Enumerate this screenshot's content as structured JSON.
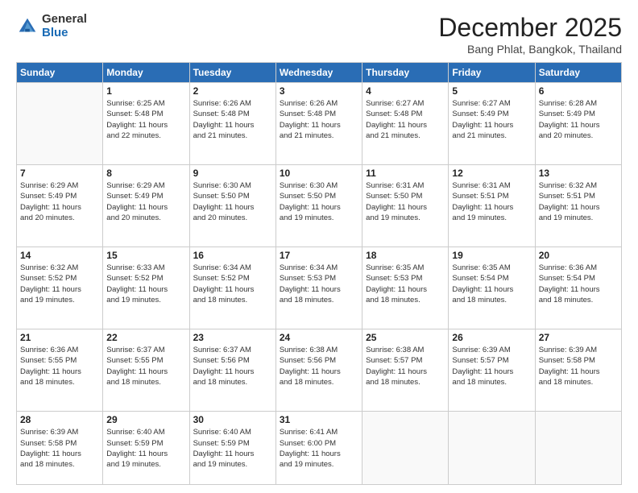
{
  "header": {
    "logo_general": "General",
    "logo_blue": "Blue",
    "month_title": "December 2025",
    "location": "Bang Phlat, Bangkok, Thailand"
  },
  "weekdays": [
    "Sunday",
    "Monday",
    "Tuesday",
    "Wednesday",
    "Thursday",
    "Friday",
    "Saturday"
  ],
  "weeks": [
    [
      {
        "day": "",
        "sunrise": "",
        "sunset": "",
        "daylight": ""
      },
      {
        "day": "1",
        "sunrise": "Sunrise: 6:25 AM",
        "sunset": "Sunset: 5:48 PM",
        "daylight": "Daylight: 11 hours and 22 minutes."
      },
      {
        "day": "2",
        "sunrise": "Sunrise: 6:26 AM",
        "sunset": "Sunset: 5:48 PM",
        "daylight": "Daylight: 11 hours and 21 minutes."
      },
      {
        "day": "3",
        "sunrise": "Sunrise: 6:26 AM",
        "sunset": "Sunset: 5:48 PM",
        "daylight": "Daylight: 11 hours and 21 minutes."
      },
      {
        "day": "4",
        "sunrise": "Sunrise: 6:27 AM",
        "sunset": "Sunset: 5:48 PM",
        "daylight": "Daylight: 11 hours and 21 minutes."
      },
      {
        "day": "5",
        "sunrise": "Sunrise: 6:27 AM",
        "sunset": "Sunset: 5:49 PM",
        "daylight": "Daylight: 11 hours and 21 minutes."
      },
      {
        "day": "6",
        "sunrise": "Sunrise: 6:28 AM",
        "sunset": "Sunset: 5:49 PM",
        "daylight": "Daylight: 11 hours and 20 minutes."
      }
    ],
    [
      {
        "day": "7",
        "sunrise": "Sunrise: 6:29 AM",
        "sunset": "Sunset: 5:49 PM",
        "daylight": "Daylight: 11 hours and 20 minutes."
      },
      {
        "day": "8",
        "sunrise": "Sunrise: 6:29 AM",
        "sunset": "Sunset: 5:49 PM",
        "daylight": "Daylight: 11 hours and 20 minutes."
      },
      {
        "day": "9",
        "sunrise": "Sunrise: 6:30 AM",
        "sunset": "Sunset: 5:50 PM",
        "daylight": "Daylight: 11 hours and 20 minutes."
      },
      {
        "day": "10",
        "sunrise": "Sunrise: 6:30 AM",
        "sunset": "Sunset: 5:50 PM",
        "daylight": "Daylight: 11 hours and 19 minutes."
      },
      {
        "day": "11",
        "sunrise": "Sunrise: 6:31 AM",
        "sunset": "Sunset: 5:50 PM",
        "daylight": "Daylight: 11 hours and 19 minutes."
      },
      {
        "day": "12",
        "sunrise": "Sunrise: 6:31 AM",
        "sunset": "Sunset: 5:51 PM",
        "daylight": "Daylight: 11 hours and 19 minutes."
      },
      {
        "day": "13",
        "sunrise": "Sunrise: 6:32 AM",
        "sunset": "Sunset: 5:51 PM",
        "daylight": "Daylight: 11 hours and 19 minutes."
      }
    ],
    [
      {
        "day": "14",
        "sunrise": "Sunrise: 6:32 AM",
        "sunset": "Sunset: 5:52 PM",
        "daylight": "Daylight: 11 hours and 19 minutes."
      },
      {
        "day": "15",
        "sunrise": "Sunrise: 6:33 AM",
        "sunset": "Sunset: 5:52 PM",
        "daylight": "Daylight: 11 hours and 19 minutes."
      },
      {
        "day": "16",
        "sunrise": "Sunrise: 6:34 AM",
        "sunset": "Sunset: 5:52 PM",
        "daylight": "Daylight: 11 hours and 18 minutes."
      },
      {
        "day": "17",
        "sunrise": "Sunrise: 6:34 AM",
        "sunset": "Sunset: 5:53 PM",
        "daylight": "Daylight: 11 hours and 18 minutes."
      },
      {
        "day": "18",
        "sunrise": "Sunrise: 6:35 AM",
        "sunset": "Sunset: 5:53 PM",
        "daylight": "Daylight: 11 hours and 18 minutes."
      },
      {
        "day": "19",
        "sunrise": "Sunrise: 6:35 AM",
        "sunset": "Sunset: 5:54 PM",
        "daylight": "Daylight: 11 hours and 18 minutes."
      },
      {
        "day": "20",
        "sunrise": "Sunrise: 6:36 AM",
        "sunset": "Sunset: 5:54 PM",
        "daylight": "Daylight: 11 hours and 18 minutes."
      }
    ],
    [
      {
        "day": "21",
        "sunrise": "Sunrise: 6:36 AM",
        "sunset": "Sunset: 5:55 PM",
        "daylight": "Daylight: 11 hours and 18 minutes."
      },
      {
        "day": "22",
        "sunrise": "Sunrise: 6:37 AM",
        "sunset": "Sunset: 5:55 PM",
        "daylight": "Daylight: 11 hours and 18 minutes."
      },
      {
        "day": "23",
        "sunrise": "Sunrise: 6:37 AM",
        "sunset": "Sunset: 5:56 PM",
        "daylight": "Daylight: 11 hours and 18 minutes."
      },
      {
        "day": "24",
        "sunrise": "Sunrise: 6:38 AM",
        "sunset": "Sunset: 5:56 PM",
        "daylight": "Daylight: 11 hours and 18 minutes."
      },
      {
        "day": "25",
        "sunrise": "Sunrise: 6:38 AM",
        "sunset": "Sunset: 5:57 PM",
        "daylight": "Daylight: 11 hours and 18 minutes."
      },
      {
        "day": "26",
        "sunrise": "Sunrise: 6:39 AM",
        "sunset": "Sunset: 5:57 PM",
        "daylight": "Daylight: 11 hours and 18 minutes."
      },
      {
        "day": "27",
        "sunrise": "Sunrise: 6:39 AM",
        "sunset": "Sunset: 5:58 PM",
        "daylight": "Daylight: 11 hours and 18 minutes."
      }
    ],
    [
      {
        "day": "28",
        "sunrise": "Sunrise: 6:39 AM",
        "sunset": "Sunset: 5:58 PM",
        "daylight": "Daylight: 11 hours and 18 minutes."
      },
      {
        "day": "29",
        "sunrise": "Sunrise: 6:40 AM",
        "sunset": "Sunset: 5:59 PM",
        "daylight": "Daylight: 11 hours and 19 minutes."
      },
      {
        "day": "30",
        "sunrise": "Sunrise: 6:40 AM",
        "sunset": "Sunset: 5:59 PM",
        "daylight": "Daylight: 11 hours and 19 minutes."
      },
      {
        "day": "31",
        "sunrise": "Sunrise: 6:41 AM",
        "sunset": "Sunset: 6:00 PM",
        "daylight": "Daylight: 11 hours and 19 minutes."
      },
      {
        "day": "",
        "sunrise": "",
        "sunset": "",
        "daylight": ""
      },
      {
        "day": "",
        "sunrise": "",
        "sunset": "",
        "daylight": ""
      },
      {
        "day": "",
        "sunrise": "",
        "sunset": "",
        "daylight": ""
      }
    ]
  ]
}
